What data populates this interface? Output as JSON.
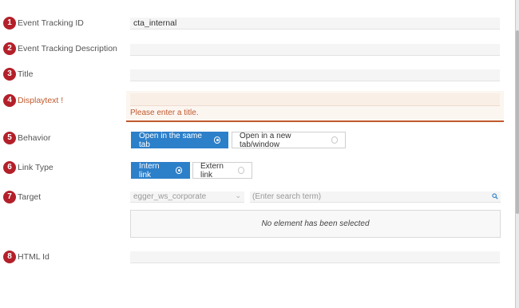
{
  "fields": [
    {
      "num": "1",
      "label": "Event Tracking ID",
      "value": "cta_internal"
    },
    {
      "num": "2",
      "label": "Event Tracking Description",
      "value": ""
    },
    {
      "num": "3",
      "label": "Title",
      "value": ""
    },
    {
      "num": "4",
      "label": "Displaytext",
      "required_mark": "!",
      "value": "",
      "error": "Please enter a title."
    },
    {
      "num": "5",
      "label": "Behavior"
    },
    {
      "num": "6",
      "label": "Link Type"
    },
    {
      "num": "7",
      "label": "Target"
    },
    {
      "num": "8",
      "label": "HTML Id",
      "value": ""
    }
  ],
  "behavior": {
    "options": [
      {
        "label": "Open in the same tab",
        "selected": true
      },
      {
        "label": "Open in a new tab/window",
        "selected": false
      }
    ]
  },
  "link_type": {
    "options": [
      {
        "label": "Intern link",
        "selected": true
      },
      {
        "label": "Extern link",
        "selected": false
      }
    ]
  },
  "target": {
    "site_select": "egger_ws_corporate",
    "search_placeholder": "(Enter search term)",
    "empty_message": "No element has been selected"
  },
  "colors": {
    "accent": "#2c7fc9",
    "badge": "#b3202a",
    "error": "#c05a2e"
  },
  "icons": [
    "chevron-down-icon",
    "search-icon",
    "radio-icon"
  ]
}
